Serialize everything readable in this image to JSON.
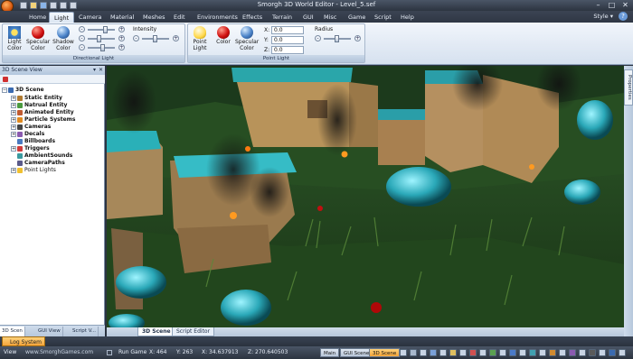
{
  "window": {
    "title": "Smorgh 3D World Editor - Level_5.sef",
    "minimize": "–",
    "maximize": "□",
    "close": "✕"
  },
  "menu": {
    "tabs": [
      "Home",
      "Light",
      "Camera",
      "Material",
      "Meshes",
      "Edit",
      "Environments",
      "Effects",
      "Terrain",
      "GUI",
      "Misc",
      "Game",
      "Script",
      "Help"
    ],
    "active": "Light",
    "style_label": "Style"
  },
  "ribbon": {
    "directional": {
      "label": "Directional Light",
      "light_color": "Light Color",
      "specular_color": "Specular Color",
      "shadow_color": "Shadow Color",
      "intensity_label": "Intensity"
    },
    "point": {
      "label": "Point Light",
      "point_light": "Point Light",
      "color": "Color",
      "specular_color": "Specular Color",
      "x_label": "X:",
      "x_value": "0.0",
      "y_label": "Y:",
      "y_value": "0.0",
      "z_label": "Z:",
      "z_value": "0.0",
      "radius_label": "Radius"
    }
  },
  "scene_view": {
    "title": "3D Scene View",
    "root": "3D Scene",
    "items": [
      {
        "label": "Static Entity",
        "expandable": true
      },
      {
        "label": "Natrual Entity",
        "expandable": true
      },
      {
        "label": "Animated Entity",
        "expandable": true
      },
      {
        "label": "Particle Systems",
        "expandable": true
      },
      {
        "label": "Cameras",
        "expandable": true
      },
      {
        "label": "Decals",
        "expandable": true
      },
      {
        "label": "Billboards",
        "expandable": false
      },
      {
        "label": "Triggers",
        "expandable": true
      },
      {
        "label": "AmbientSounds",
        "expandable": false
      },
      {
        "label": "CameraPaths",
        "expandable": false
      },
      {
        "label": "Point Lights",
        "expandable": true
      }
    ],
    "tabs": [
      "3D Scen",
      "GUI View",
      "Script V..."
    ]
  },
  "viewport_tabs": [
    "3D Scene",
    "Script Editor"
  ],
  "properties_label": "Properties",
  "log": {
    "tab": "Log System"
  },
  "status": {
    "view_label": "View",
    "watermark": "www.SmorghGames.com",
    "run_game": "Run Game",
    "x": "X: 464",
    "y": "Y: 263",
    "coord_x": "X: 34.637913",
    "coord_z": "Z: 270.640503",
    "mode_buttons": [
      "Main",
      "GUI Scene",
      "3D Scene"
    ],
    "active_mode": "3D Scene"
  },
  "colors": {
    "accent": "#f4a43a",
    "chrome": "#2c3440",
    "ribbon": "#dce6f2"
  }
}
